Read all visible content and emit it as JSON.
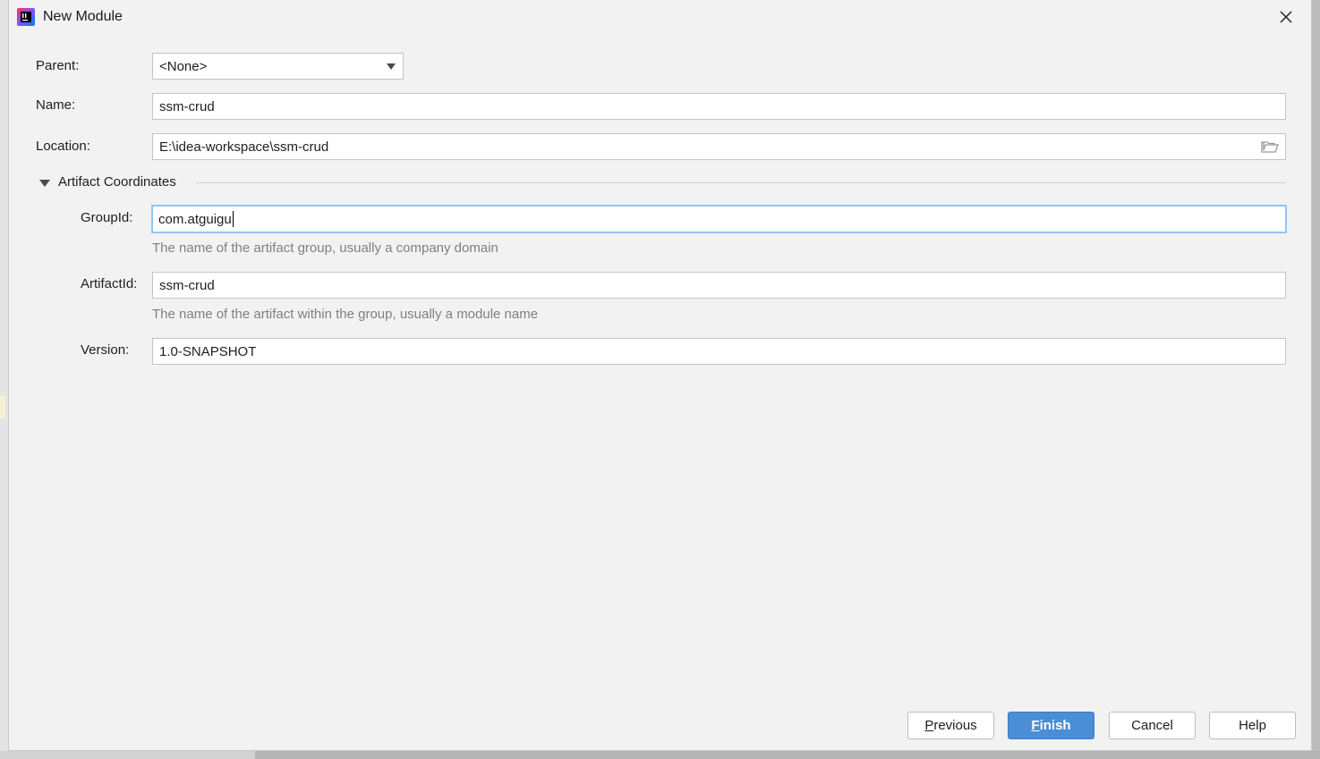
{
  "window": {
    "title": "New Module"
  },
  "form": {
    "parent": {
      "label": "Parent:",
      "value": "<None>"
    },
    "name": {
      "label": "Name:",
      "value": "ssm-crud"
    },
    "location": {
      "label": "Location:",
      "value": "E:\\idea-workspace\\ssm-crud"
    }
  },
  "artifact": {
    "section_title": "Artifact Coordinates",
    "group_id": {
      "label": "GroupId:",
      "value": "com.atguigu",
      "hint": "The name of the artifact group, usually a company domain"
    },
    "artifact_id": {
      "label": "ArtifactId:",
      "value": "ssm-crud",
      "hint": "The name of the artifact within the group, usually a module name"
    },
    "version": {
      "label": "Version:",
      "value": "1.0-SNAPSHOT"
    }
  },
  "buttons": {
    "previous": {
      "mnemonic": "P",
      "rest": "revious"
    },
    "finish": {
      "mnemonic": "F",
      "rest": "inish"
    },
    "cancel": "Cancel",
    "help": "Help"
  },
  "colors": {
    "accent": "#4a8fd6",
    "focus_ring": "#97c3f3",
    "dialog_bg": "#f2f2f2"
  }
}
